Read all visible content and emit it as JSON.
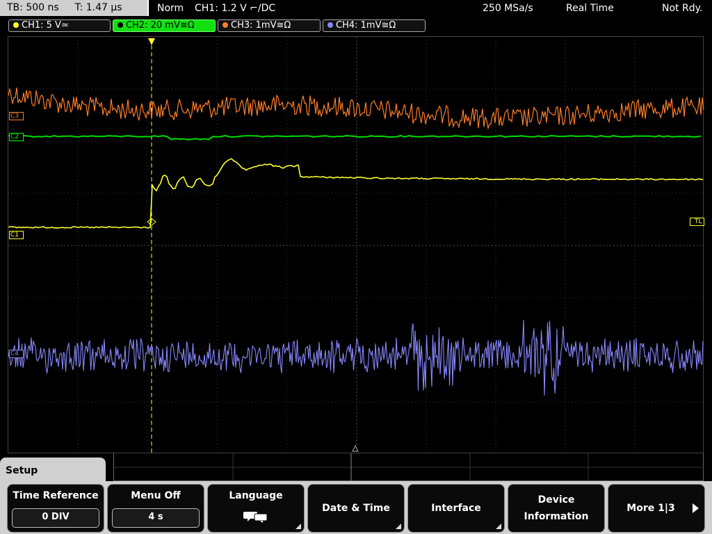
{
  "topbar": {
    "timebase": "TB: 500 ns",
    "trigger_time": "T: 1.47 µs",
    "mode": "Norm",
    "trigger_setting": "CH1: 1.2 V ⌐/DC",
    "sample_rate": "250 MSa/s",
    "acq_mode": "Real Time",
    "status": "Not Rdy."
  },
  "channels": [
    {
      "label": "CH1: 5 V≃",
      "color": "#ffff33",
      "active": false
    },
    {
      "label": "CH2: 20 mV≅Ω",
      "color": "#00ff00",
      "active": true
    },
    {
      "label": "CH3: 1mV≅Ω",
      "color": "#ff7f2a",
      "active": false
    },
    {
      "label": "CH4: 1mV≅Ω",
      "color": "#8888ff",
      "active": false
    }
  ],
  "screen": {
    "markers": {
      "c3": "C3",
      "c2": "C2",
      "c1": "C1",
      "c4": "C4",
      "trigger_level": "TL"
    },
    "colors": {
      "grid": "#3a3a3a",
      "trigger_line": "#ffff33"
    }
  },
  "softkeys": {
    "setup_tab": "Setup",
    "time_reference": {
      "label": "Time Reference",
      "value": "0 DIV"
    },
    "menu_off": {
      "label": "Menu Off",
      "value": "4 s"
    },
    "language": {
      "label": "Language",
      "icon": "speech-bubble-icon"
    },
    "date_time": {
      "label": "Date & Time"
    },
    "interface": {
      "label": "Interface"
    },
    "device_information": {
      "label_line1": "Device",
      "label_line2": "Information"
    },
    "more": {
      "label": "More 1|3"
    }
  }
}
